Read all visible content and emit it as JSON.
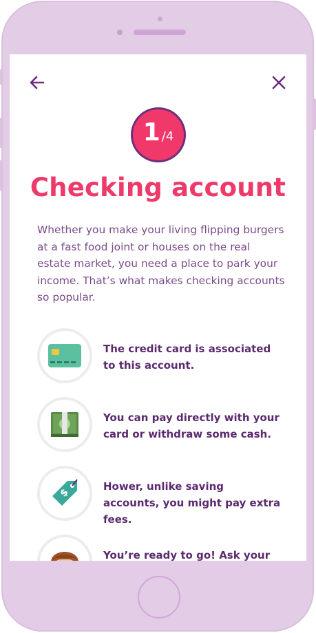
{
  "step": {
    "current": "1",
    "separator": "/",
    "total": "4"
  },
  "title": "Checking account",
  "description": "Whether you make your living flipping burgers at a fast food joint or houses on the real estate market, you need a place to park your income. That’s what makes checking accounts so popular.",
  "features": [
    {
      "icon": "credit-card-icon",
      "text": "The credit card is associated to this account."
    },
    {
      "icon": "cash-icon",
      "text": "You can pay directly with your card or withdraw some cash."
    },
    {
      "icon": "price-tag-icon",
      "text": "Hower, unlike saving accounts, you might pay extra fees."
    },
    {
      "icon": "avatar-icon",
      "text": "You’re ready to go! Ask your"
    }
  ],
  "colors": {
    "accent": "#f0386b",
    "primary": "#6b2e7c",
    "phone_frame": "#e3cce6",
    "text": "#7b4a8a"
  }
}
